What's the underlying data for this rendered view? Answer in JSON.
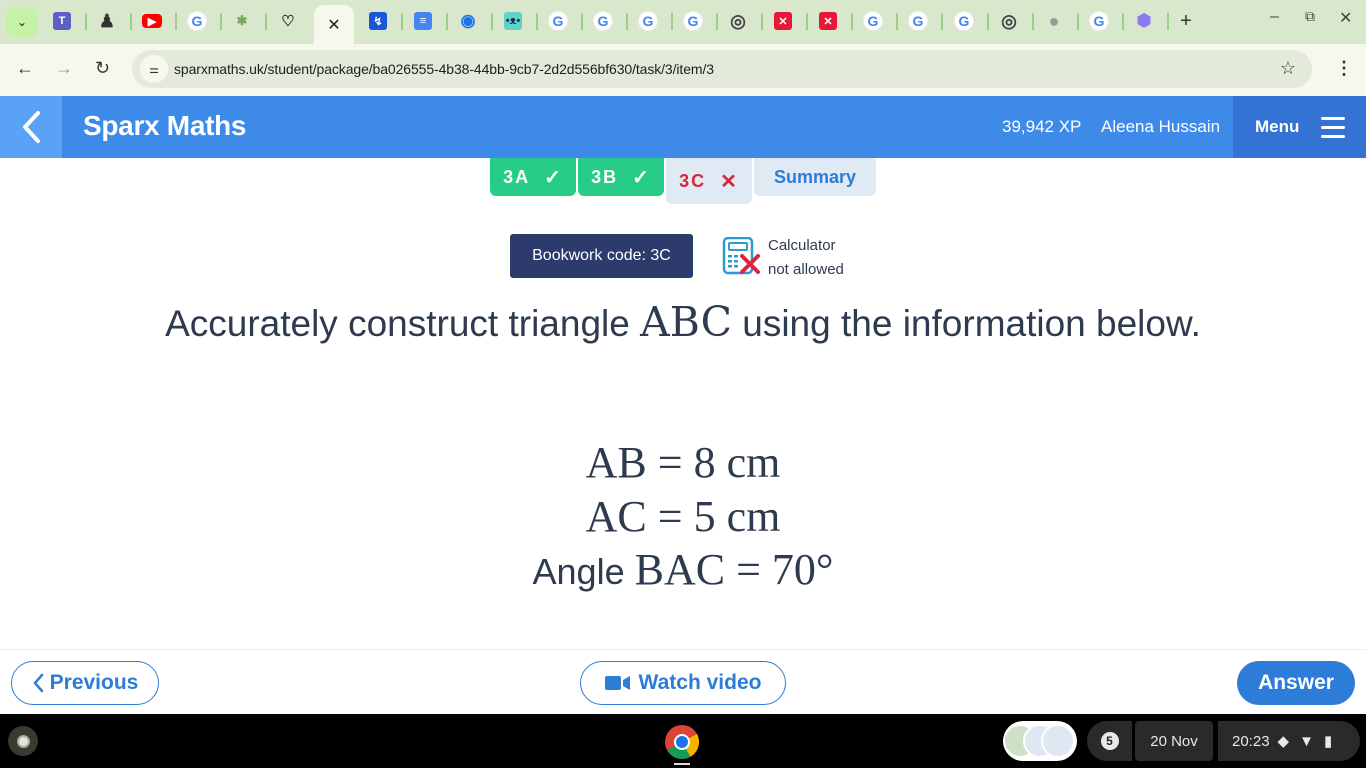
{
  "browser": {
    "tabs": [
      {
        "icon": "teams-icon"
      },
      {
        "icon": "person-icon"
      },
      {
        "icon": "youtube-icon"
      },
      {
        "icon": "google-icon"
      },
      {
        "icon": "kids-icon"
      },
      {
        "icon": "heart-icon"
      },
      {
        "icon": "close-icon",
        "active": true
      },
      {
        "icon": "sparx-icon"
      },
      {
        "icon": "docs-icon"
      },
      {
        "icon": "check-circle-icon"
      },
      {
        "icon": "chat-bot-icon"
      },
      {
        "icon": "google-icon"
      },
      {
        "icon": "google-icon"
      },
      {
        "icon": "google-icon"
      },
      {
        "icon": "google-icon"
      },
      {
        "icon": "chrome-icon"
      },
      {
        "icon": "xodo-icon"
      },
      {
        "icon": "xodo-icon"
      },
      {
        "icon": "google-icon"
      },
      {
        "icon": "google-icon"
      },
      {
        "icon": "google-icon"
      },
      {
        "icon": "chrome-icon"
      },
      {
        "icon": "globe-icon"
      },
      {
        "icon": "google-icon"
      },
      {
        "icon": "gem-icon"
      }
    ],
    "new_tab_label": "+",
    "active_tab_close": "✕",
    "url": "sparxmaths.uk/student/package/ba026555-4b38-44bb-9cb7-2d2d556bf630/task/3/item/3"
  },
  "app": {
    "brand": "Sparx Maths",
    "xp": "39,942 XP",
    "user": "Aleena Hussain",
    "menu_label": "Menu",
    "task_tabs": [
      {
        "label": "3A",
        "status": "✓"
      },
      {
        "label": "3B",
        "status": "✓"
      },
      {
        "label": "3C",
        "status": "✕"
      },
      {
        "label": "Summary"
      }
    ],
    "bookwork": "Bookwork code: 3C",
    "calculator_line1": "Calculator",
    "calculator_line2": "not allowed",
    "question_pre": "Accurately construct triangle ",
    "question_math": "ABC",
    "question_post": " using the information below.",
    "facts": [
      {
        "prefix": "",
        "expr": "AB = 8 cm"
      },
      {
        "prefix": "",
        "expr": "AC = 5 cm"
      },
      {
        "prefix": "Angle ",
        "expr": "BAC = 70°"
      }
    ],
    "previous_label": "Previous",
    "watch_video_label": "Watch video",
    "answer_label": "Answer"
  },
  "shelf": {
    "notification_count": "5",
    "date": "20 Nov",
    "time": "20:23"
  },
  "colors": {
    "header_blue": "#3d8ae9",
    "done_green": "#27cd86",
    "error_red": "#d9263c",
    "accent_blue": "#2d7cd8",
    "bookwork_navy": "#2d3a6b"
  }
}
